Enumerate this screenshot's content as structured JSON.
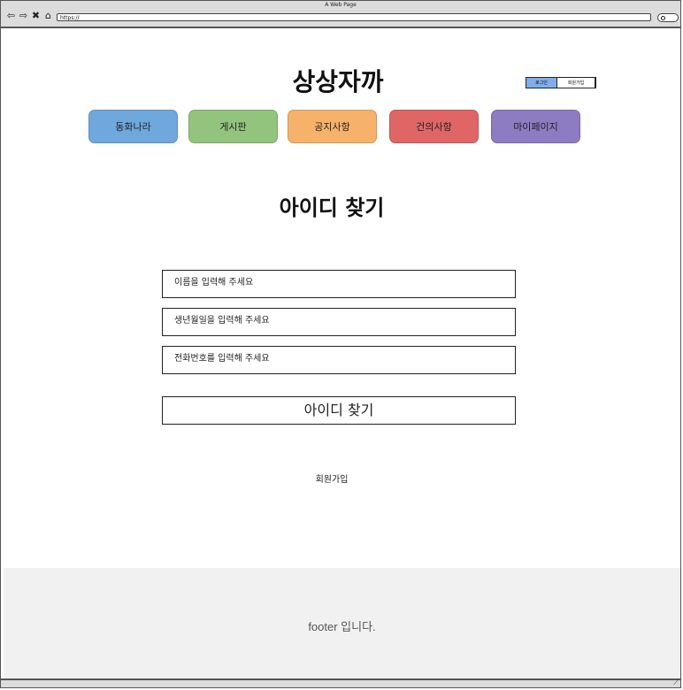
{
  "window": {
    "title": "A Web Page",
    "url": "https://"
  },
  "nav_icons": [
    "back-icon",
    "forward-icon",
    "close-icon",
    "home-icon"
  ],
  "header": {
    "site_title": "상상자까",
    "login_label": "로그인",
    "signup_label": "회원가입"
  },
  "menu": [
    {
      "label": "동화나라",
      "color": "#6fa8dc"
    },
    {
      "label": "게시판",
      "color": "#93c47d"
    },
    {
      "label": "공지사항",
      "color": "#f6b26b"
    },
    {
      "label": "건의사항",
      "color": "#e06666"
    },
    {
      "label": "마이페이지",
      "color": "#8e7cc3"
    }
  ],
  "main": {
    "heading": "아이디 찾기",
    "fields": [
      {
        "placeholder": "이름을 입력해 주세요"
      },
      {
        "placeholder": "생년월일을 입력해 주세요"
      },
      {
        "placeholder": "전화번호를 입력해 주세요"
      }
    ],
    "submit_label": "아이디 찾기",
    "signup_link": "회원가입"
  },
  "footer": {
    "text": "footer 입니다."
  }
}
